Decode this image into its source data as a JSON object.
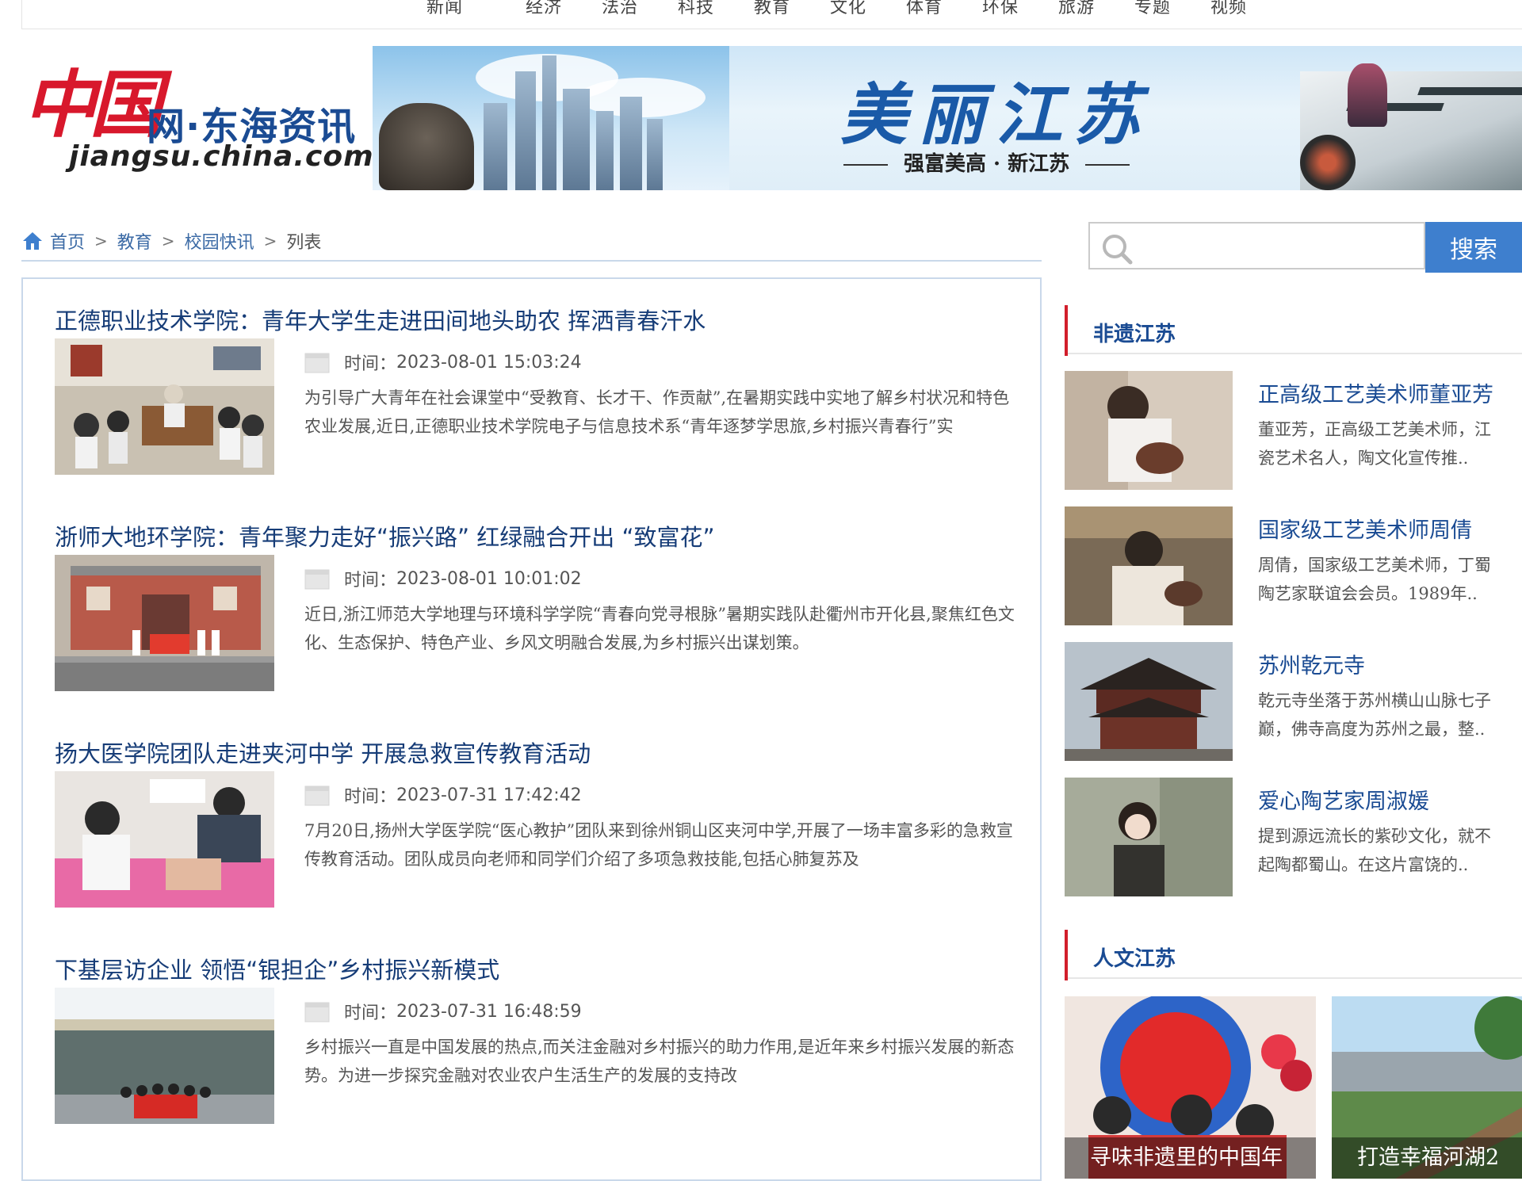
{
  "nav": {
    "items": [
      "新闻",
      "经济",
      "法治",
      "科技",
      "教育",
      "文化",
      "体育",
      "环保",
      "旅游",
      "专题",
      "视频"
    ]
  },
  "logo": {
    "mark": "中国",
    "name": "网·东海资讯",
    "url": "jiangsu.china.com.cn"
  },
  "banner": {
    "title": "美丽江苏",
    "subtitle": "强富美高 · 新江苏"
  },
  "breadcrumb": {
    "items": [
      "首页",
      "教育",
      "校园快讯"
    ],
    "current": "列表",
    "separator": ">"
  },
  "articles": [
    {
      "title": "正德职业技术学院：青年大学生走进田间地头助农  挥洒青春汗水",
      "time_label": "时间：",
      "time": "2023-08-01 15:03:24",
      "summary": "为引导广大青年在社会课堂中“受教育、长才干、作贡献”,在暑期实践中实地了解乡村状况和特色农业发展,近日,正德职业技术学院电子与信息技术系“青年逐梦学思旅,乡村振兴青春行”实"
    },
    {
      "title": "浙师大地环学院：青年聚力走好“振兴路”  红绿融合开出 “致富花”",
      "time_label": "时间：",
      "time": "2023-08-01 10:01:02",
      "summary": "近日,浙江师范大学地理与环境科学学院“青春向党寻根脉”暑期实践队赴衢州市开化县,聚焦红色文化、生态保护、特色产业、乡风文明融合发展,为乡村振兴出谋划策。"
    },
    {
      "title": "扬大医学院团队走进夹河中学  开展急救宣传教育活动",
      "time_label": "时间：",
      "time": "2023-07-31 17:42:42",
      "summary": "7月20日,扬州大学医学院“医心教护”团队来到徐州铜山区夹河中学,开展了一场丰富多彩的急救宣传教育活动。团队成员向老师和同学们介绍了多项急救技能,包括心肺复苏及"
    },
    {
      "title": "下基层访企业  领悟“银担企”乡村振兴新模式",
      "time_label": "时间：",
      "time": "2023-07-31 16:48:59",
      "summary": "乡村振兴一直是中国发展的热点,而关注金融对乡村振兴的助力作用,是近年来乡村振兴发展的新态势。为进一步探究金融对农业农户生活生产的发展的支持改"
    }
  ],
  "search": {
    "placeholder": "",
    "button": "搜索"
  },
  "sections": {
    "heritage_title": "非遗江苏",
    "humanities_title": "人文江苏"
  },
  "heritage": [
    {
      "title": "正高级工艺美术师董亚芳",
      "summary": "董亚芳，正高级工艺美术师，江\n瓷艺术名人，陶文化宣传推.."
    },
    {
      "title": "国家级工艺美术师周倩",
      "summary": "周倩，国家级工艺美术师，丁蜀\n陶艺家联谊会会员。1989年.."
    },
    {
      "title": "苏州乾元寺",
      "summary": "乾元寺坐落于苏州横山山脉七子\n巅，佛寺高度为苏州之最，整.."
    },
    {
      "title": "爱心陶艺家周淑媛",
      "summary": "提到源远流长的紫砂文化，就不\n起陶都蜀山。在这片富饶的.."
    }
  ],
  "humanities": [
    {
      "caption": "寻味非遗里的中国年"
    },
    {
      "caption": "打造幸福河湖2"
    }
  ],
  "colors": {
    "link_blue": "#163c77",
    "accent_blue": "#3e7fce",
    "section_red": "#d21e2b",
    "logo_red": "#d8182c"
  }
}
